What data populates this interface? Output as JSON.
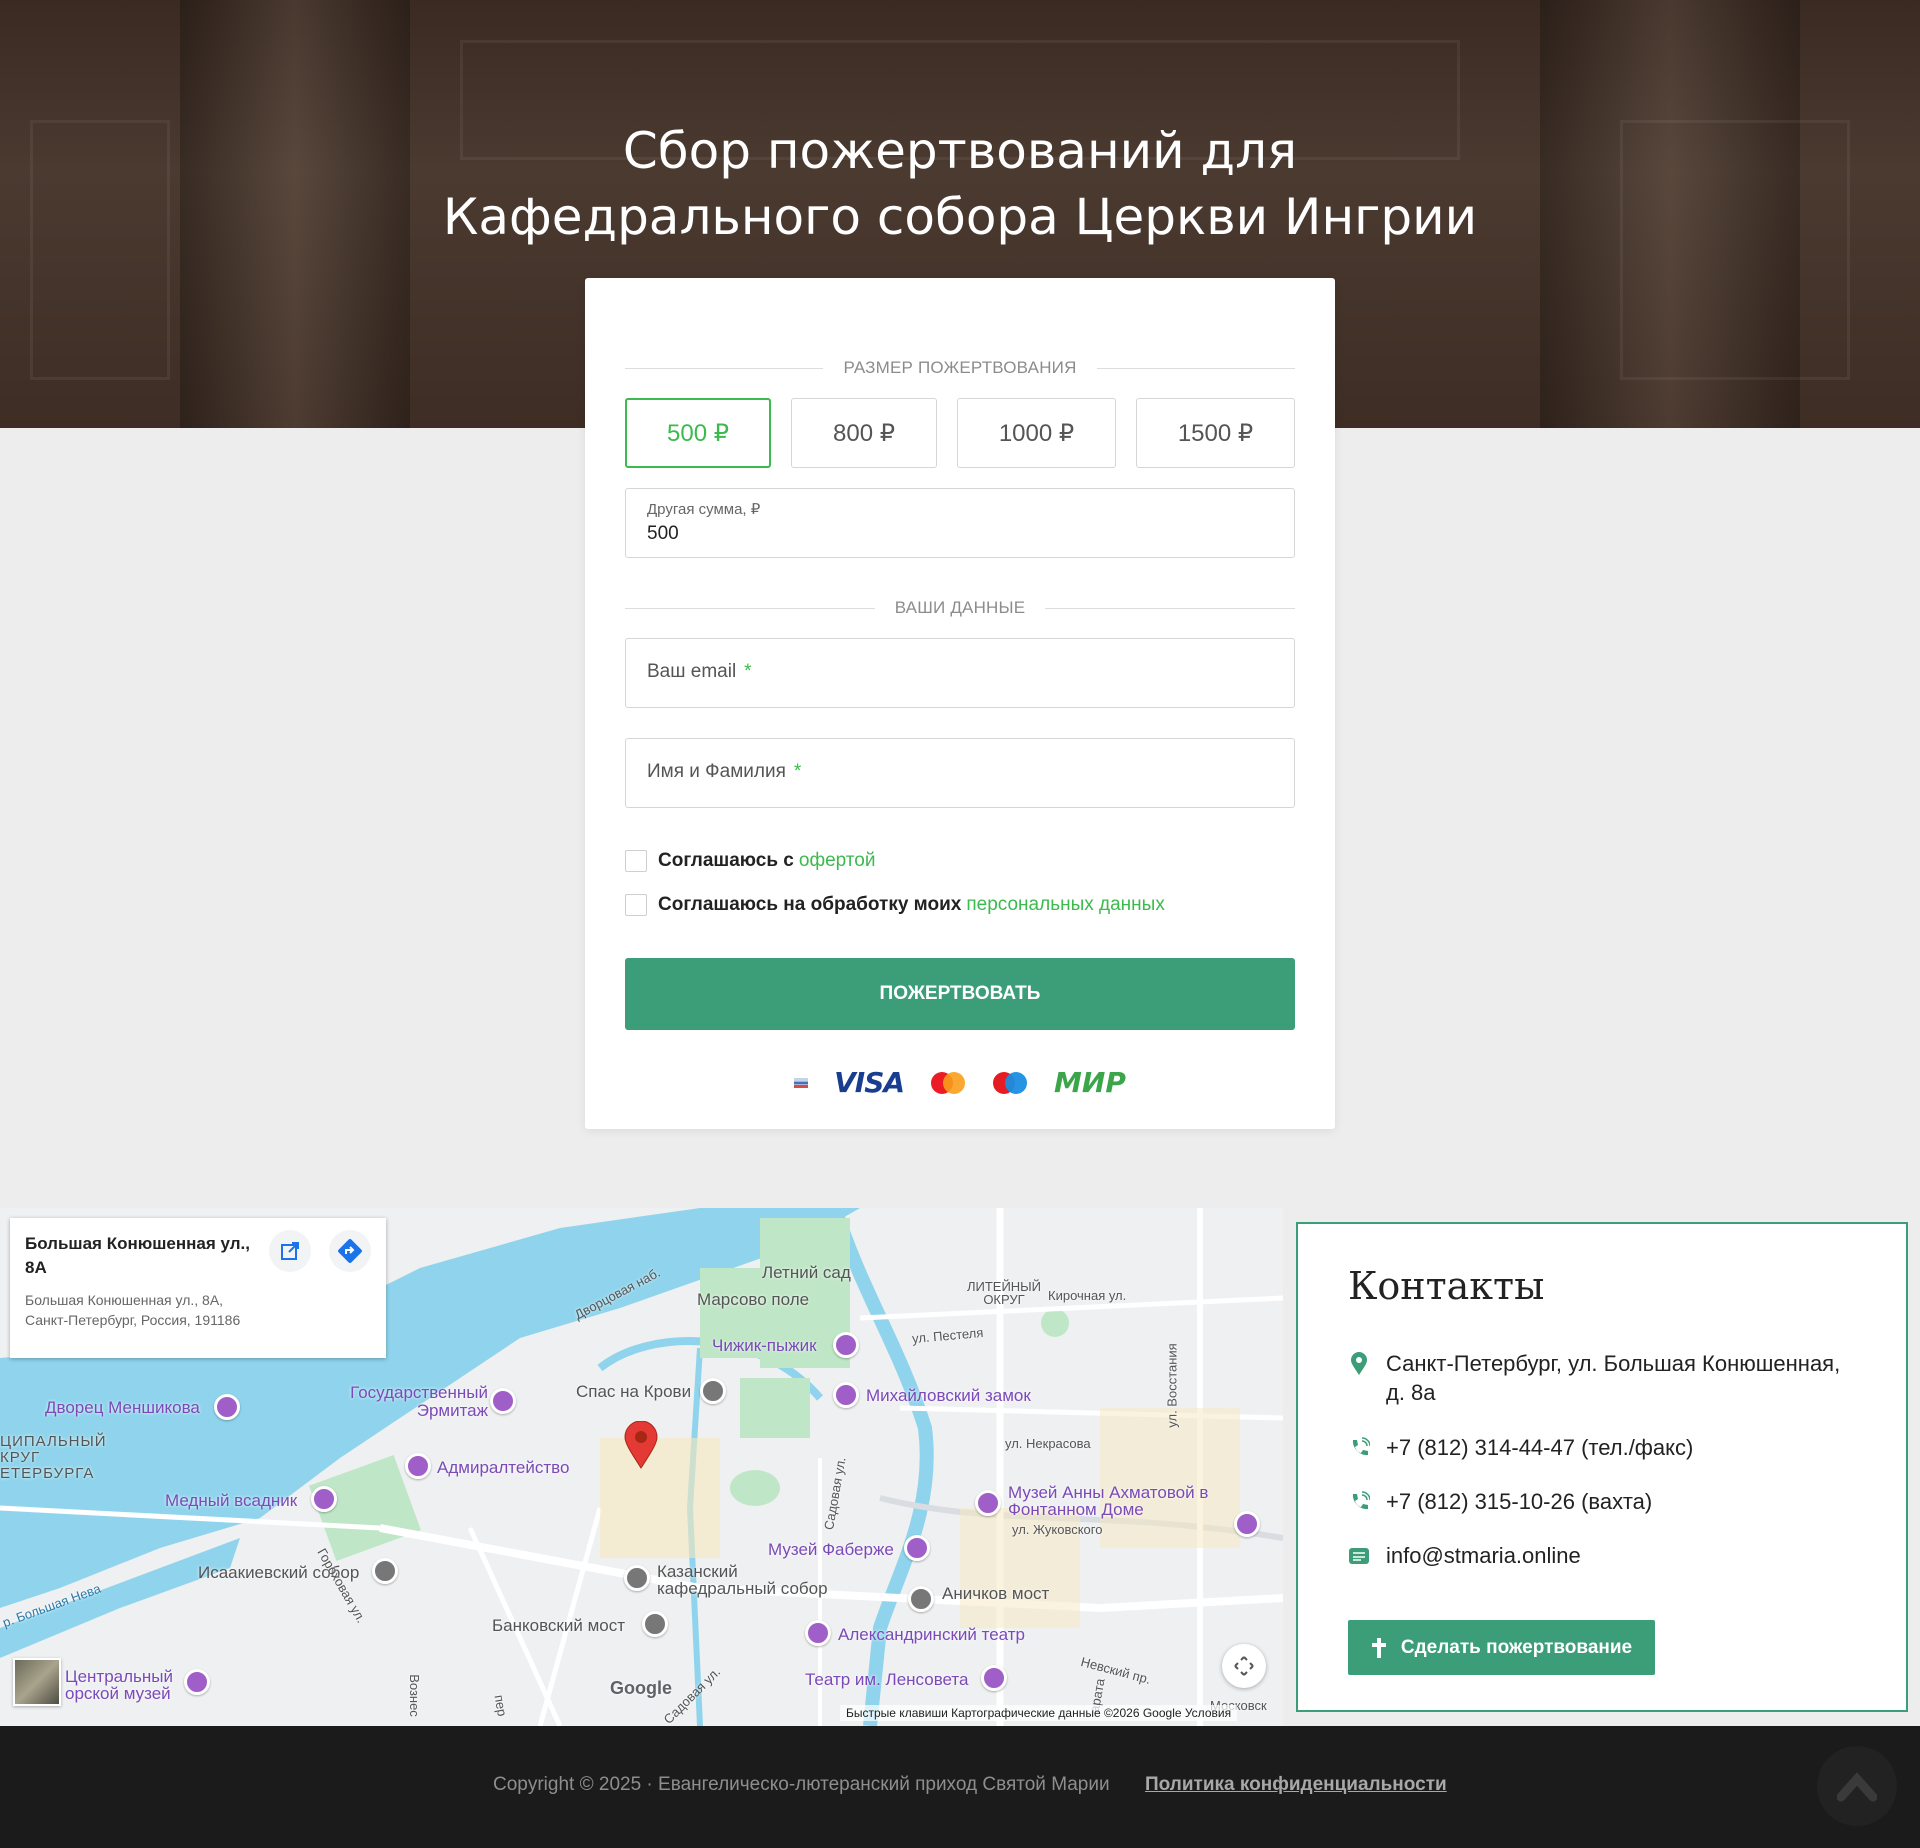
{
  "hero": {
    "title_line1": "Сбор пожертвований для",
    "title_line2": "Кафедрального собора Церкви Ингрии"
  },
  "form": {
    "amount_section": "Размер пожертвования",
    "amounts": [
      "500 ₽",
      "800 ₽",
      "1000 ₽",
      "1500 ₽"
    ],
    "selected_amount_index": 0,
    "other_amount_label": "Другая сумма, ₽",
    "other_amount_value": "500",
    "data_section": "Ваши данные",
    "email_placeholder": "Ваш email",
    "name_placeholder": "Имя и Фамилия",
    "required_mark": "*",
    "agree_offer_text": "Соглашаюсь с",
    "agree_offer_link": "офертой",
    "agree_personal_text": "Соглашаюсь на обработку моих",
    "agree_personal_link": "персональных данных",
    "submit_label": "Пожертвовать",
    "payment_logos": {
      "visa": "VISA",
      "mir": "МИР"
    }
  },
  "map": {
    "info_title": "Большая Конюшенная ул., 8А",
    "info_address": "Большая Конюшенная ул., 8А, Санкт-Петербург, Россия, 191186",
    "labels": {
      "letniy_sad": "Летний сад",
      "marsovo_pole": "Марсово поле",
      "dvortsovaya": "Дворцовая наб.",
      "liteyny": "ЛИТЕЙНЫЙ ОКРУГ",
      "kirochnaya": "Кирочная ул.",
      "chizhik": "Чижик-пыжик",
      "pestelya": "ул. Пестеля",
      "vosstaniya": "ул. Восстания",
      "dvorets_menshikova": "Дворец Меншикова",
      "ermitazh": "Государственный Эрмитаж",
      "spas": "Спас на Крови",
      "mikhaylovsky": "Михайловский замок",
      "nekrasova": "ул. Некрасова",
      "okrug": "ЦИПАЛЬНЫЙ КРУГ ЕТЕРБУРГА",
      "admiralteystvo": "Адмиралтейство",
      "medny": "Медный всадник",
      "sadovaya": "Садовая ул.",
      "akhmatova": "Музей Анны Ахматовой в Фонтанном Доме",
      "zhukovskogo": "ул. Жуковского",
      "faberge": "Музей Фаберже",
      "isaakievsky": "Исаакиевский собор",
      "gorokhovaya": "Гороховая ул.",
      "kazansky": "Казанский кафедральный собор",
      "anichkov": "Аничков мост",
      "bolshaya_neva": "р. Большая Нева",
      "bankovsky": "Банковский мост",
      "aleksandrinsky": "Александринский театр",
      "tsentralny": "Центральный военно-морской музей",
      "tsentralny_visible": "Центральный орской музей",
      "lensoveta": "Театр им. Ленсовета",
      "nevsky": "Невский пр.",
      "voznes": "Вознес",
      "per": "пер",
      "arata": "арата",
      "sadovaya2": "Садовая ул.",
      "google": "Google",
      "moskovsky": "Московск"
    },
    "attribution": "Быстрые клавиши    Картографические данные ©2026 Google    Условия"
  },
  "contacts": {
    "title": "Контакты",
    "address": "Санкт-Петербург, ул. Большая Конюшенная, д. 8а",
    "phone1": "+7 (812) 314-44-47 (тел./факс)",
    "phone2": "+7 (812) 315-10-26 (вахта)",
    "email": "info@stmaria.online",
    "button_label": "Сделать пожертвование",
    "accent_color": "#3c9e78"
  },
  "footer": {
    "copyright": "Copyright © 2025 · Евангелическо-лютеранский приход Святой Марии",
    "privacy_link": "Политика конфиденциальности"
  }
}
